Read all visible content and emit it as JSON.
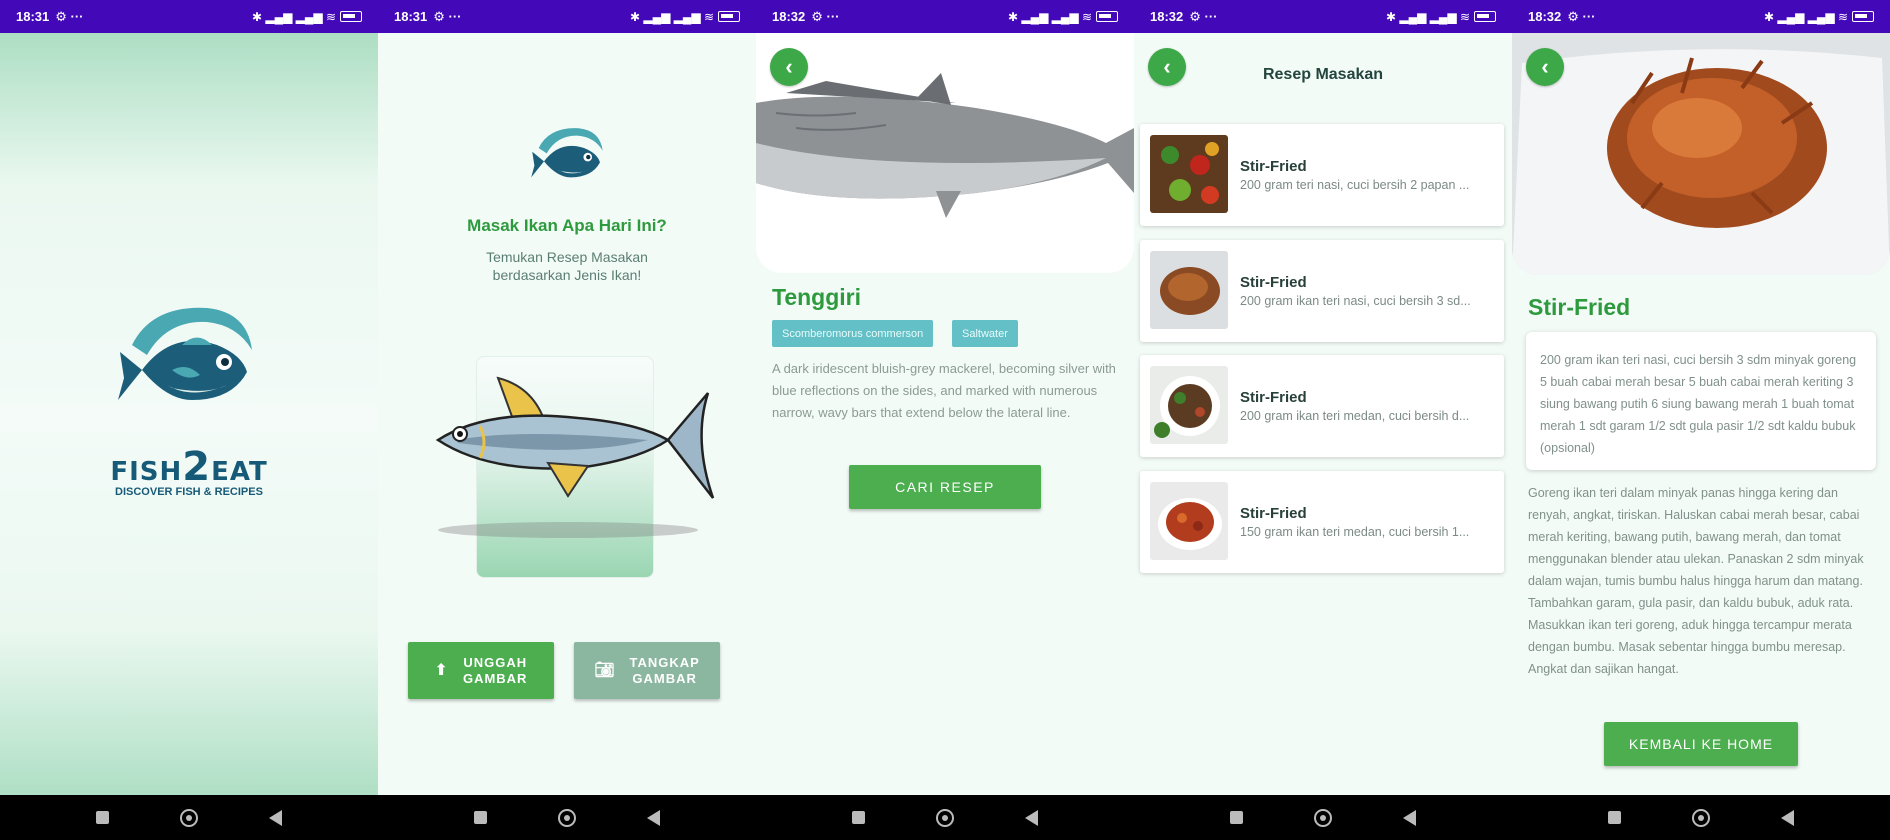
{
  "status": [
    {
      "time": "18:31"
    },
    {
      "time": "18:31"
    },
    {
      "time": "18:32"
    },
    {
      "time": "18:32"
    },
    {
      "time": "18:32"
    }
  ],
  "splash": {
    "brand_left": "FISH",
    "brand_two": "2",
    "brand_right": "EAT",
    "tagline": "DISCOVER FISH & RECIPES"
  },
  "home": {
    "title": "Masak Ikan Apa Hari Ini?",
    "subtitle_line1": "Temukan Resep Masakan",
    "subtitle_line2": "berdasarkan Jenis Ikan!",
    "upload_label_1": "UNGGAH",
    "upload_label_2": "GAMBAR",
    "capture_label_1": "TANGKAP",
    "capture_label_2": "GAMBAR"
  },
  "fish_detail": {
    "name": "Tenggiri",
    "scientific_name": "Scomberomorus commerson",
    "habitat": "Saltwater",
    "description": "A dark iridescent bluish-grey mackerel, becoming silver with blue reflections on the sides, and marked with numerous narrow, wavy bars that extend below the lateral line.",
    "search_button": "CARI RESEP"
  },
  "recipe_list": {
    "title": "Resep Masakan",
    "items": [
      {
        "name": "Stir-Fried",
        "desc": "200 gram teri nasi, cuci bersih 2 papan ..."
      },
      {
        "name": "Stir-Fried",
        "desc": "200 gram ikan teri nasi, cuci bersih 3 sd..."
      },
      {
        "name": "Stir-Fried",
        "desc": "200 gram ikan teri medan, cuci bersih d..."
      },
      {
        "name": "Stir-Fried",
        "desc": "150 gram ikan teri medan, cuci bersih 1..."
      }
    ]
  },
  "recipe_detail": {
    "name": "Stir-Fried",
    "ingredients": "200 gram ikan teri nasi, cuci bersih 3 sdm minyak goreng 5 buah cabai merah besar 5 buah cabai merah keriting 3 siung bawang putih 6 siung bawang merah 1 buah tomat merah 1 sdt garam 1/2 sdt gula pasir 1/2 sdt kaldu bubuk (opsional)",
    "steps": "Goreng ikan teri dalam minyak panas hingga kering dan renyah, angkat, tiriskan. Haluskan cabai merah besar, cabai merah keriting, bawang putih, bawang merah, dan tomat menggunakan blender atau ulekan. Panaskan 2 sdm minyak dalam wajan, tumis bumbu halus hingga harum dan matang. Tambahkan garam, gula pasir, dan kaldu bubuk, aduk rata. Masukkan ikan teri goreng, aduk hingga tercampur merata dengan bumbu. Masak sebentar hingga bumbu meresap. Angkat dan sajikan hangat.",
    "home_button": "KEMBALI KE HOME"
  },
  "colors": {
    "status_bar": "#4308b8",
    "primary_green": "#4cae4f",
    "title_green": "#2e9a3e",
    "chip_teal": "#62c0c6",
    "capture_grey_green": "#8bb69f"
  }
}
